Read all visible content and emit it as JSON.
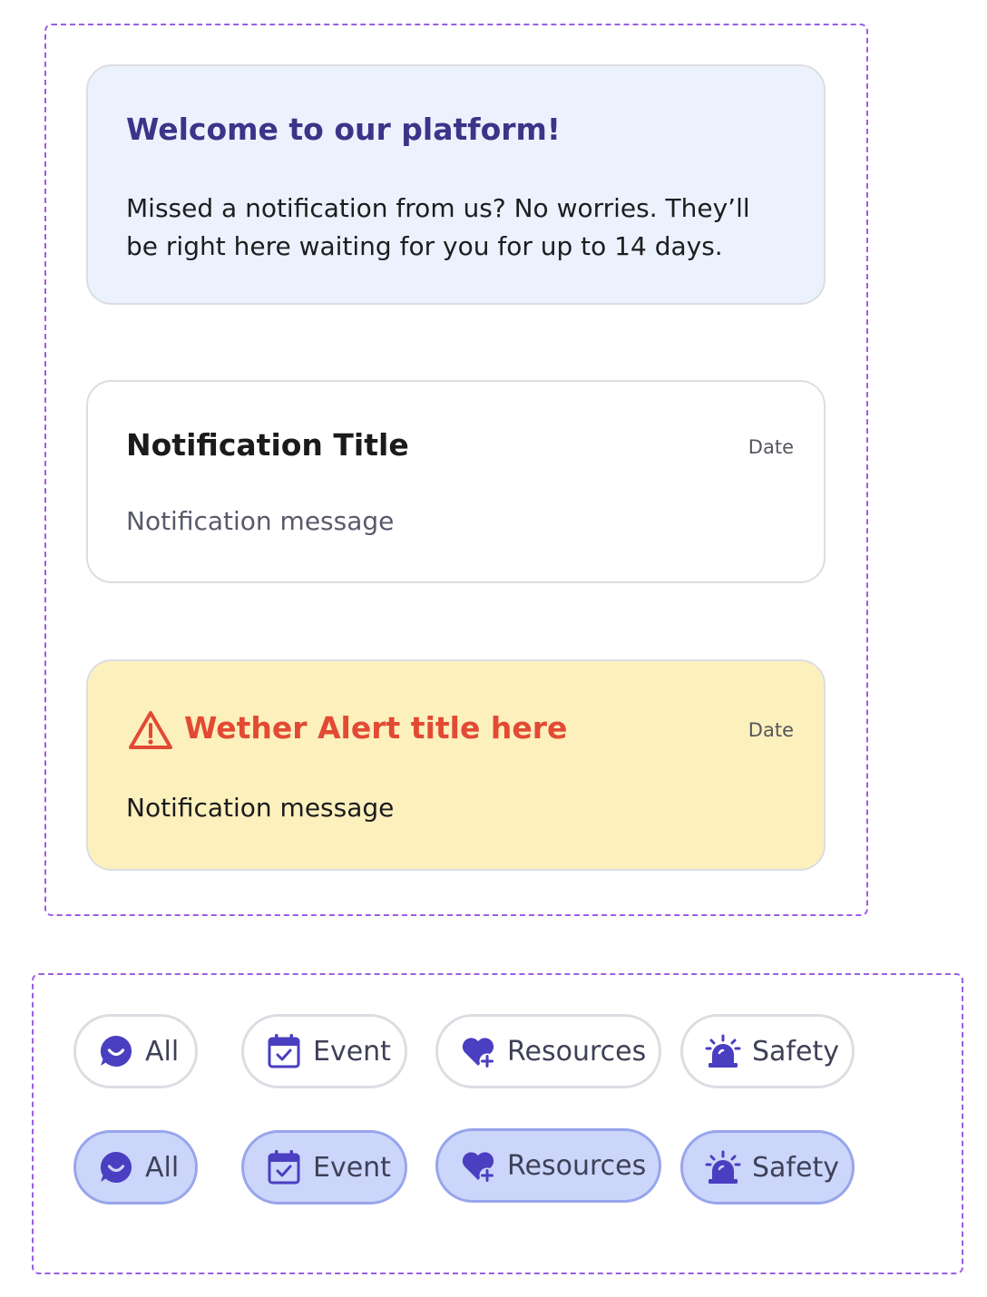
{
  "welcome": {
    "title": "Welcome to our platform!",
    "body": "Missed a notification from us? No worries. They’ll be right here waiting for you for up to 14 days."
  },
  "notification": {
    "title": "Notification Title",
    "date": "Date",
    "message": "Notification message"
  },
  "alert": {
    "icon": "warning-triangle-icon",
    "title": "Wether Alert title here",
    "date": "Date",
    "message": "Notification message"
  },
  "filters": {
    "default_row": [
      {
        "label": "All",
        "icon": "chat-smile-icon"
      },
      {
        "label": "Event",
        "icon": "calendar-check-icon"
      },
      {
        "label": "Resources",
        "icon": "heart-plus-icon"
      },
      {
        "label": "Safety",
        "icon": "siren-icon"
      }
    ],
    "selected_row": [
      {
        "label": "All",
        "icon": "chat-smile-icon"
      },
      {
        "label": "Event",
        "icon": "calendar-check-icon"
      },
      {
        "label": "Resources",
        "icon": "heart-plus-icon"
      },
      {
        "label": "Safety",
        "icon": "siren-icon"
      }
    ]
  },
  "colors": {
    "frame_dash": "#9b5de5",
    "welcome_bg": "#ebf2fd",
    "welcome_title": "#3d3389",
    "alert_bg": "#fcf0bd",
    "alert_title": "#e24a34",
    "chip_icon": "#4a3ec1",
    "chip_active_bg": "#cbd6fa",
    "chip_active_border": "#98a5ec"
  }
}
